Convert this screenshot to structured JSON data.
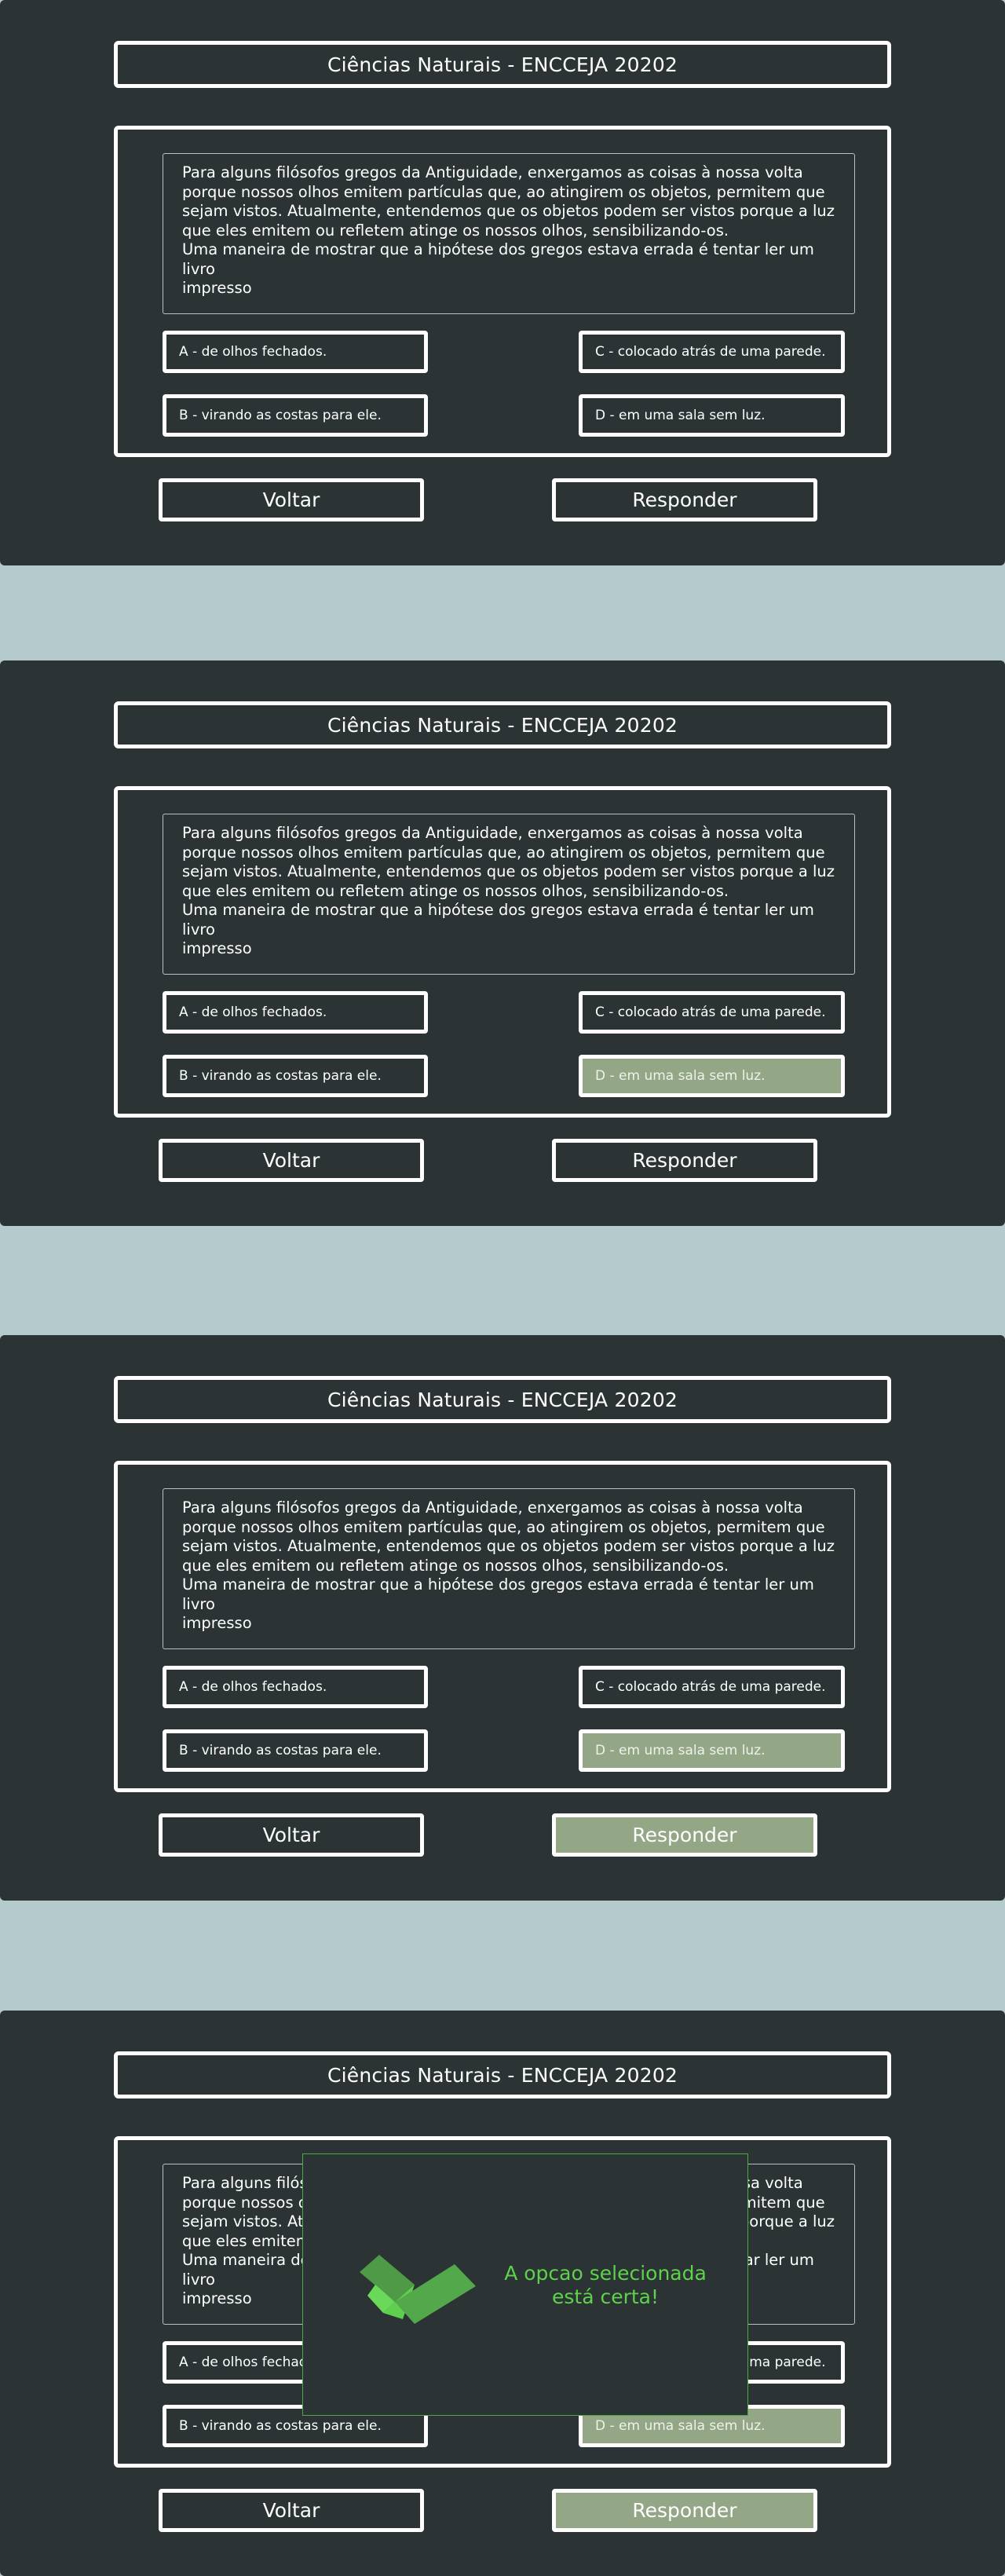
{
  "title": "Ciências Naturais - ENCCEJA 20202",
  "question_lines": [
    "Para alguns filósofos gregos da Antiguidade, enxergamos as coisas à nossa volta",
    "porque nossos olhos emitem partículas que, ao atingirem os objetos, permitem que",
    "sejam vistos. Atualmente, entendemos que os objetos podem ser vistos porque a luz",
    "que eles emitem ou refletem atinge os nossos olhos, sensibilizando-os.",
    "Uma maneira de mostrar que a hipótese dos gregos estava errada é tentar ler um livro",
    "impresso"
  ],
  "options": {
    "a": "A - de olhos fechados.",
    "b": "B - virando as costas para ele.",
    "c": "C - colocado atrás de uma parede.",
    "d": "D - em uma sala sem luz."
  },
  "buttons": {
    "back": "Voltar",
    "answer": "Responder"
  },
  "modal": {
    "line1": "A opcao selecionada",
    "line2": "está certa!",
    "icon": "checkmark-icon"
  },
  "colors": {
    "background": "#b5cacc",
    "panel": "#2b3335",
    "selected": "#93a686",
    "success": "#5ed24a",
    "modal_border": "#4caa44"
  },
  "states": [
    {
      "selected_option": null,
      "answer_active": false,
      "modal_visible": false
    },
    {
      "selected_option": "d",
      "answer_active": false,
      "modal_visible": false
    },
    {
      "selected_option": "d",
      "answer_active": true,
      "modal_visible": false
    },
    {
      "selected_option": "d",
      "answer_active": true,
      "modal_visible": true
    }
  ]
}
